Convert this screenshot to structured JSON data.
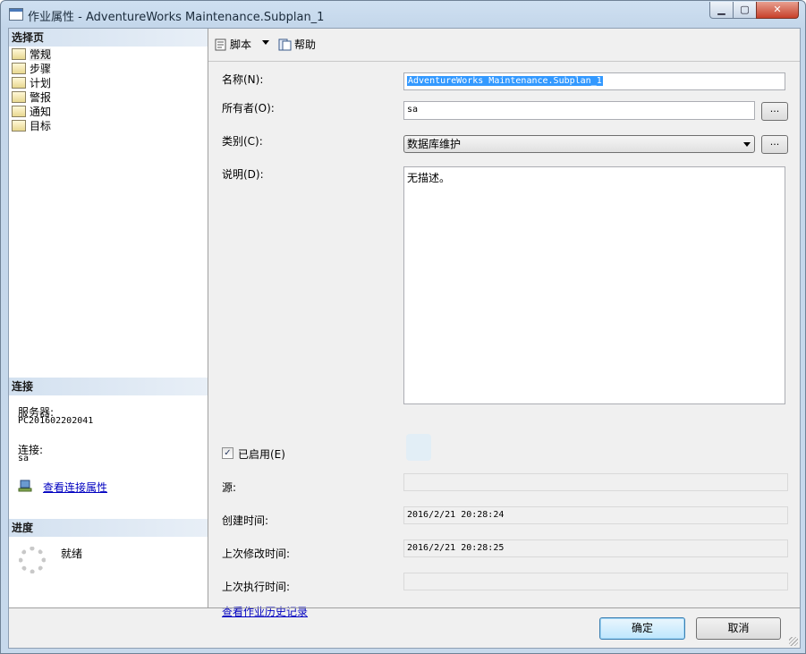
{
  "window": {
    "title": "作业属性 - AdventureWorks Maintenance.Subplan_1",
    "min_glyph": "▁",
    "max_glyph": "▢",
    "close_glyph": "✕"
  },
  "sidebar": {
    "select_page_header": "选择页",
    "pages": [
      {
        "label": "常规",
        "selected": true,
        "icon": "page-properties-icon"
      },
      {
        "label": "步骤",
        "selected": false,
        "icon": "page-properties-icon"
      },
      {
        "label": "计划",
        "selected": false,
        "icon": "page-properties-icon"
      },
      {
        "label": "警报",
        "selected": false,
        "icon": "page-properties-icon"
      },
      {
        "label": "通知",
        "selected": false,
        "icon": "page-properties-icon"
      },
      {
        "label": "目标",
        "selected": false,
        "icon": "page-properties-icon"
      }
    ],
    "connection_header": "连接",
    "server_label": "服务器:",
    "server_value": "PC201602202041",
    "connection_label": "连接:",
    "connection_value": "sa",
    "view_connection_link": "查看连接属性",
    "progress_header": "进度",
    "progress_status": "就绪"
  },
  "toolbar": {
    "script_label": "脚本",
    "help_label": "帮助"
  },
  "form": {
    "name_label": "名称(N):",
    "name_value": "AdventureWorks Maintenance.Subplan_1",
    "owner_label": "所有者(O):",
    "owner_value": "sa",
    "category_label": "类别(C):",
    "category_value": "数据库维护",
    "description_label": "说明(D):",
    "description_value": "无描述。",
    "enabled_label": "已启用(E)",
    "enabled": true,
    "source_label": "源:",
    "source_value": "",
    "created_label": "创建时间:",
    "created_value": "2016/2/21 20:28:24",
    "modified_label": "上次修改时间:",
    "modified_value": "2016/2/21 20:28:25",
    "executed_label": "上次执行时间:",
    "executed_value": "",
    "history_link": "查看作业历史记录",
    "browse_label": "..."
  },
  "footer": {
    "ok_label": "确定",
    "cancel_label": "取消"
  },
  "colors": {
    "link": "#0000c0",
    "selection": "#3399ff"
  }
}
